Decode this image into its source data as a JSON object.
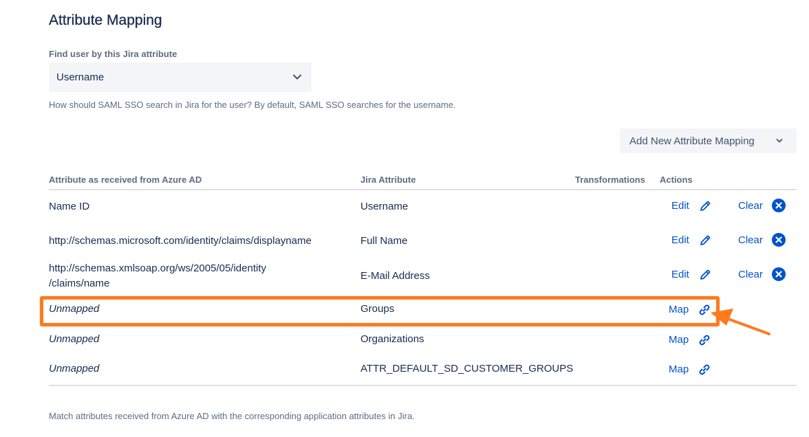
{
  "title": "Attribute Mapping",
  "find_user": {
    "label": "Find user by this Jira attribute",
    "selected": "Username",
    "help": "How should SAML SSO search in Jira for the user? By default, SAML SSO searches for the username."
  },
  "add_button": {
    "label": "Add New Attribute Mapping"
  },
  "table": {
    "headers": {
      "source": "Attribute as received from Azure AD",
      "jira": "Jira Attribute",
      "transformations": "Transformations",
      "actions": "Actions"
    },
    "rows": [
      {
        "source": "Name ID",
        "jira": "Username",
        "primary_action": "Edit",
        "secondary_action": "Clear"
      },
      {
        "source": "http://schemas.microsoft.com/identity/claims/displayname",
        "jira": "Full Name",
        "primary_action": "Edit",
        "secondary_action": "Clear"
      },
      {
        "source_line1": "http://schemas.xmlsoap.org/ws/2005/05/identity",
        "source_line2": "/claims/name",
        "jira": "E-Mail Address",
        "primary_action": "Edit",
        "secondary_action": "Clear"
      },
      {
        "source": "Unmapped",
        "jira": "Groups",
        "primary_action": "Map"
      },
      {
        "source": "Unmapped",
        "jira": "Organizations",
        "primary_action": "Map"
      },
      {
        "source": "Unmapped",
        "jira": "ATTR_DEFAULT_SD_CUSTOMER_GROUPS",
        "primary_action": "Map"
      }
    ]
  },
  "footer": "Match attributes received from Azure AD with the corresponding application attributes in Jira.",
  "colors": {
    "link": "#0052cc",
    "highlight": "#ff7a1f",
    "muted": "#5e6c84",
    "text": "#172b4d"
  },
  "icons": {
    "edit": "pencil-icon",
    "clear": "close-circle-icon",
    "map": "link-icon",
    "dropdown": "chevron-down-icon"
  }
}
